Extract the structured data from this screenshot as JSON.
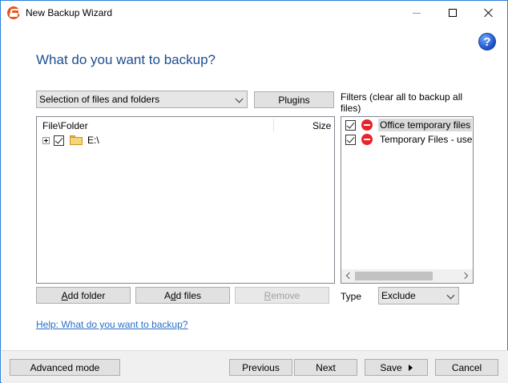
{
  "window": {
    "title": "New Backup Wizard"
  },
  "header": {
    "heading": "What do you want to backup?",
    "help_icon": "help-icon"
  },
  "source": {
    "selected": "Selection of files and folders",
    "plugins_label": "Plugins"
  },
  "tree": {
    "columns": [
      "File\\Folder",
      "Size"
    ],
    "items": [
      {
        "label": "E:\\",
        "checked": true,
        "expanded": false
      }
    ]
  },
  "tree_actions": {
    "add_folder": "Add folder",
    "add_folder_key": "A",
    "add_folder_rest": "dd folder",
    "add_files_pre": "A",
    "add_files_key": "d",
    "add_files_rest": "d files",
    "remove": "Remove",
    "remove_key": "R",
    "remove_rest": "emove"
  },
  "filters": {
    "label": "Filters (clear all to backup all files)",
    "items": [
      {
        "label": "Office temporary files",
        "checked": true,
        "selected": true
      },
      {
        "label": "Temporary Files - use a",
        "checked": true,
        "selected": false
      }
    ],
    "type_label": "Type",
    "type_value": "Exclude"
  },
  "help_link": "Help: What do you want to backup?",
  "footer": {
    "advanced_mode": "Advanced mode",
    "previous": "Previous",
    "next": "Next",
    "save": "Save",
    "cancel": "Cancel"
  },
  "colors": {
    "heading": "#1e4f8f",
    "link": "#2a6ec8",
    "window_border": "#2b7fd6"
  }
}
